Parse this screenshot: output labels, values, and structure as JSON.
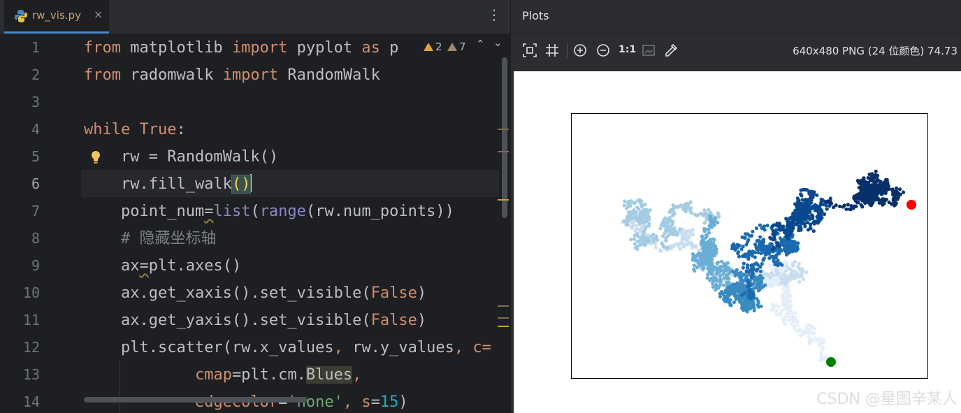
{
  "editor": {
    "tab": {
      "title": "rw_vis.py",
      "close_glyph": "×",
      "icon": "python-icon"
    },
    "menu_glyph": "⋮",
    "inspections": {
      "warnings": "2",
      "weak_warnings": "7",
      "up": "⌃",
      "down": "⌄"
    },
    "line_numbers": [
      "1",
      "2",
      "3",
      "4",
      "5",
      "6",
      "7",
      "8",
      "9",
      "10",
      "11",
      "12",
      "13",
      "14"
    ],
    "current_line": 6,
    "code": {
      "l1": {
        "from": "from",
        "mod": " matplotlib ",
        "imp": "import",
        "name": " pyplot ",
        "as": "as",
        "alias": " p"
      },
      "l2": {
        "from": "from",
        "mod": " radomwalk ",
        "imp": "import",
        "name": " RandomWalk"
      },
      "l4": {
        "kw": "while",
        "sp": " ",
        "lit": "True",
        "colon": ":"
      },
      "l5": {
        "indent": "    ",
        "text": "rw = RandomWalk()"
      },
      "l6": {
        "indent": "    ",
        "pre": "rw.fill_walk",
        "paren": "()"
      },
      "l7": {
        "indent": "    ",
        "var": "point_num",
        "eq": "=",
        "f1": "list",
        "o1": "(",
        "f2": "range",
        "rest": "(rw.num_points))"
      },
      "l8": {
        "indent": "    ",
        "text": "# 隐藏坐标轴"
      },
      "l9": {
        "indent": "    ",
        "var": "ax",
        "eq": "=",
        "rest": "plt.axes()"
      },
      "l10": {
        "indent": "    ",
        "pre": "ax.get_xaxis().set_visible(",
        "lit": "False",
        "post": ")"
      },
      "l11": {
        "indent": "    ",
        "pre": "ax.get_yaxis().set_visible(",
        "lit": "False",
        "post": ")"
      },
      "l12": {
        "indent": "    ",
        "pre": "plt.scatter(rw.x_values",
        "c1": ",",
        "mid": " rw.y_values",
        "c2": ",",
        "sp": " ",
        "kwarg": "c="
      },
      "l13": {
        "indent": "            ",
        "kwarg": "cmap",
        "eq": "=plt.cm.",
        "ref": "Blues",
        "c": ","
      },
      "l14": {
        "indent": "            ",
        "kwarg": "edgecolor",
        "eq": "=",
        "str": "'none'",
        "c": ",",
        "sp": " ",
        "s": "s",
        "eq2": "=",
        "num": "15",
        "close": ")"
      }
    }
  },
  "plots": {
    "title": "Plots",
    "toolbar": {
      "fit_icon": "fit-content-icon",
      "grid_icon": "grid-icon",
      "zoom_in_icon": "zoom-in-icon",
      "zoom_out_icon": "zoom-out-icon",
      "actual_size": "1:1",
      "background_icon": "background-icon",
      "color_picker_icon": "eyedropper-icon"
    },
    "image_info": "640x480 PNG (24 位颜色) 74.73"
  },
  "watermark": "CSDN @星图辛某人",
  "colors": {
    "editor_bg": "#1e1f22",
    "keyword": "#cf8e6d",
    "builtin": "#8888c6",
    "start_point": "#008000",
    "end_point": "#ff0000"
  }
}
